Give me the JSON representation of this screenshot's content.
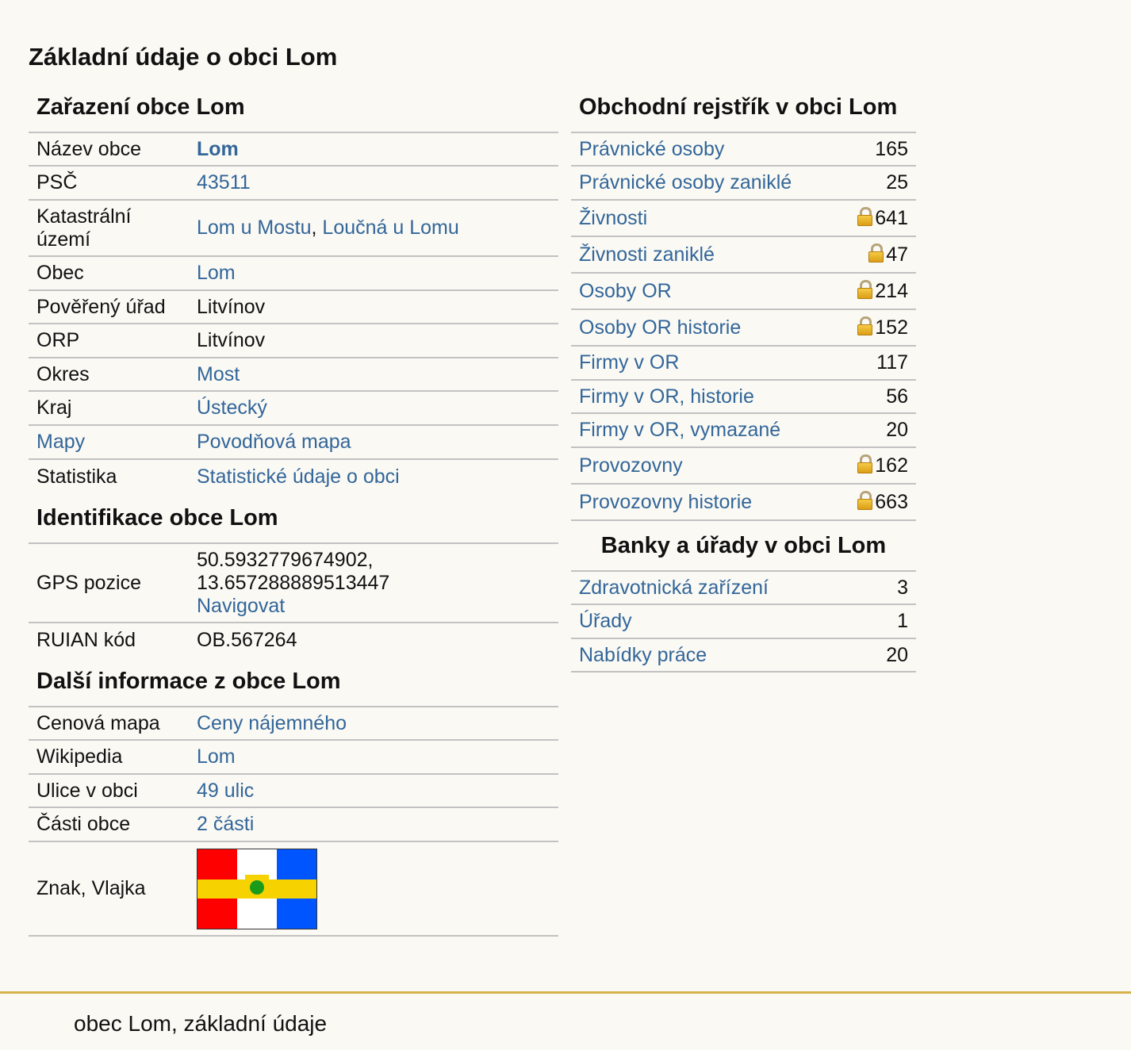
{
  "page_title": "Základní údaje o obci Lom",
  "zarazeni": {
    "heading": "Zařazení obce Lom",
    "nazev_label": "Název obce",
    "nazev_value": "Lom",
    "psc_label": "PSČ",
    "psc_value": "43511",
    "katastr_label": "Katastrální území",
    "katastr_value_1": "Lom u Mostu",
    "katastr_sep": ", ",
    "katastr_value_2": "Loučná u Lomu",
    "obec_label": "Obec",
    "obec_value": "Lom",
    "povereny_label": "Pověřený úřad",
    "povereny_value": "Litvínov",
    "orp_label": "ORP",
    "orp_value": "Litvínov",
    "okres_label": "Okres",
    "okres_value": "Most",
    "kraj_label": "Kraj",
    "kraj_value": "Ústecký",
    "mapy_label": "Mapy",
    "mapy_value": "Povodňová mapa",
    "statistika_label": "Statistika",
    "statistika_value": "Statistické údaje o obci"
  },
  "identifikace": {
    "heading": "Identifikace obce Lom",
    "gps_label": "GPS pozice",
    "gps_lat": "50.5932779674902,",
    "gps_lon": "13.657288889513447",
    "gps_nav": "Navigovat",
    "ruian_label": "RUIAN kód",
    "ruian_value": "OB.567264"
  },
  "dalsi": {
    "heading": "Další informace z obce Lom",
    "cenova_label": "Cenová mapa",
    "cenova_value": "Ceny nájemného",
    "wiki_label": "Wikipedia",
    "wiki_value": "Lom",
    "ulice_label": "Ulice v obci",
    "ulice_value": "49 ulic",
    "casti_label": "Části obce",
    "casti_value": "2 části",
    "znak_label": "Znak, Vlajka"
  },
  "flag_colors": {
    "red": "#ff0000",
    "white": "#ffffff",
    "blue": "#0055ff",
    "yellow": "#f5d200",
    "green": "#1a9c1a"
  },
  "obchodni": {
    "heading": "Obchodní rejstřík v obci Lom",
    "rows": [
      {
        "label": "Právnické osoby",
        "count": "165",
        "locked": false
      },
      {
        "label": "Právnické osoby zaniklé",
        "count": "25",
        "locked": false
      },
      {
        "label": "Živnosti",
        "count": "641",
        "locked": true
      },
      {
        "label": "Živnosti zaniklé",
        "count": "47",
        "locked": true
      },
      {
        "label": "Osoby OR",
        "count": "214",
        "locked": true
      },
      {
        "label": "Osoby OR historie",
        "count": "152",
        "locked": true
      },
      {
        "label": "Firmy v OR",
        "count": "117",
        "locked": false
      },
      {
        "label": "Firmy v OR, historie",
        "count": "56",
        "locked": false
      },
      {
        "label": "Firmy v OR, vymazané",
        "count": "20",
        "locked": false
      },
      {
        "label": "Provozovny",
        "count": "162",
        "locked": true
      },
      {
        "label": "Provozovny historie",
        "count": "663",
        "locked": true
      }
    ]
  },
  "banky": {
    "heading": "Banky a úřady v obci Lom",
    "rows": [
      {
        "label": "Zdravotnická zařízení",
        "count": "3"
      },
      {
        "label": "Úřady",
        "count": "1"
      },
      {
        "label": "Nabídky práce",
        "count": "20"
      }
    ]
  },
  "footer": {
    "text": "obec Lom, základní údaje"
  }
}
